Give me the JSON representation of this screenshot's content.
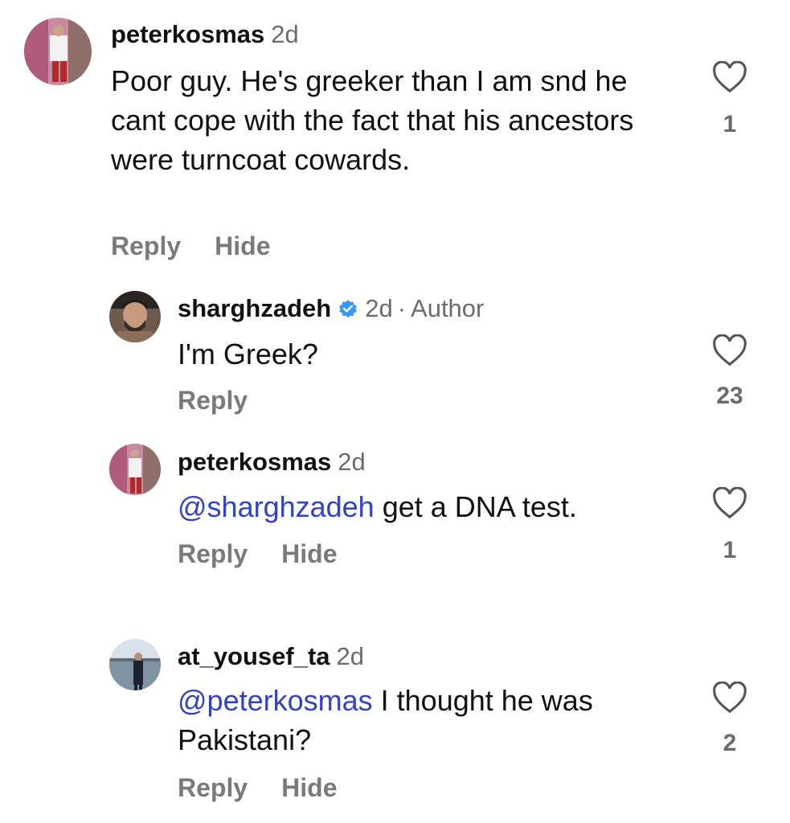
{
  "comments": [
    {
      "username": "peterkosmas",
      "time": "2d",
      "text": "Poor guy. He's greeker than I am snd he cant cope with the fact that his ancestors were turncoat cowards.",
      "reply_label": "Reply",
      "hide_label": "Hide",
      "like_count": "1",
      "icon": "heart-outline-icon"
    },
    {
      "username": "sharghzadeh",
      "verified": true,
      "time": "2d",
      "separator": "·",
      "author_label": "Author",
      "text": "I'm Greek?",
      "reply_label": "Reply",
      "like_count": "23",
      "icon": "heart-outline-icon"
    },
    {
      "username": "peterkosmas",
      "time": "2d",
      "mention": "@sharghzadeh",
      "text": " get a DNA test.",
      "reply_label": "Reply",
      "hide_label": "Hide",
      "like_count": "1",
      "icon": "heart-outline-icon"
    },
    {
      "username": "at_yousef_ta",
      "time": "2d",
      "mention": "@peterkosmas",
      "text": " I thought he was Pakistani?",
      "reply_label": "Reply",
      "hide_label": "Hide",
      "like_count": "2",
      "icon": "heart-outline-icon"
    }
  ],
  "colors": {
    "mention": "#3142c6",
    "verified": "#3897f0",
    "muted": "#6b6b6b"
  }
}
